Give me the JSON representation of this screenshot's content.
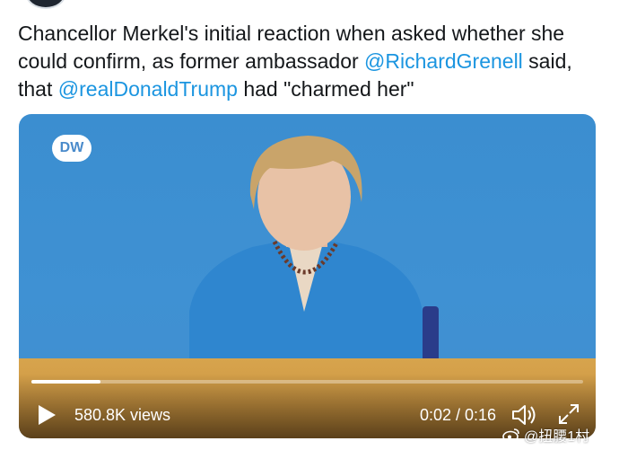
{
  "tweet": {
    "text_before": "Chancellor Merkel's initial reaction when asked whether she could confirm, as former ambassador ",
    "mention_1": "@RichardGrenell",
    "text_middle": " said, that ",
    "mention_2": "@realDonaldTrump",
    "text_after": " had \"charmed her\""
  },
  "video": {
    "channel_logo": "DW",
    "views": "580.8K views",
    "time": "0:02 / 0:16",
    "progress": 0.125,
    "play_icon": "play-icon",
    "volume_icon": "volume-icon",
    "expand_icon": "expand-icon"
  },
  "watermark": {
    "icon": "weibo-icon",
    "text": "@扭腰1村"
  }
}
